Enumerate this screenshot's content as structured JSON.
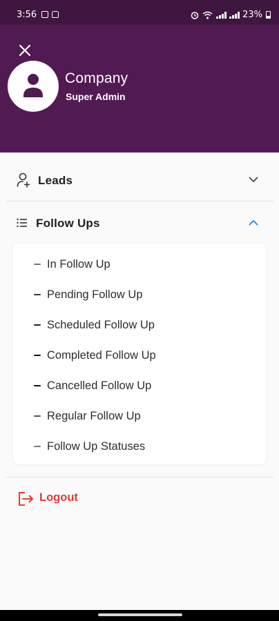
{
  "status_bar": {
    "time": "3:56",
    "battery": "23%"
  },
  "header": {
    "company": "Company",
    "role": "Super Admin"
  },
  "menu": {
    "leads": {
      "label": "Leads",
      "expanded": false
    },
    "follow_ups": {
      "label": "Follow Ups",
      "expanded": true,
      "items": [
        {
          "label": "In Follow Up"
        },
        {
          "label": "Pending Follow Up"
        },
        {
          "label": "Scheduled Follow Up"
        },
        {
          "label": "Completed Follow Up"
        },
        {
          "label": "Cancelled Follow Up"
        },
        {
          "label": "Regular Follow Up"
        },
        {
          "label": "Follow Up Statuses"
        }
      ]
    },
    "logout": {
      "label": "Logout"
    }
  },
  "colors": {
    "header_bg": "#521a53",
    "accent_blue": "#1e88e5",
    "logout_red": "#e53935"
  },
  "icons": [
    "close-icon",
    "person-icon",
    "add-user-icon",
    "list-icon",
    "chevron-down-icon",
    "chevron-up-icon",
    "logout-icon"
  ]
}
